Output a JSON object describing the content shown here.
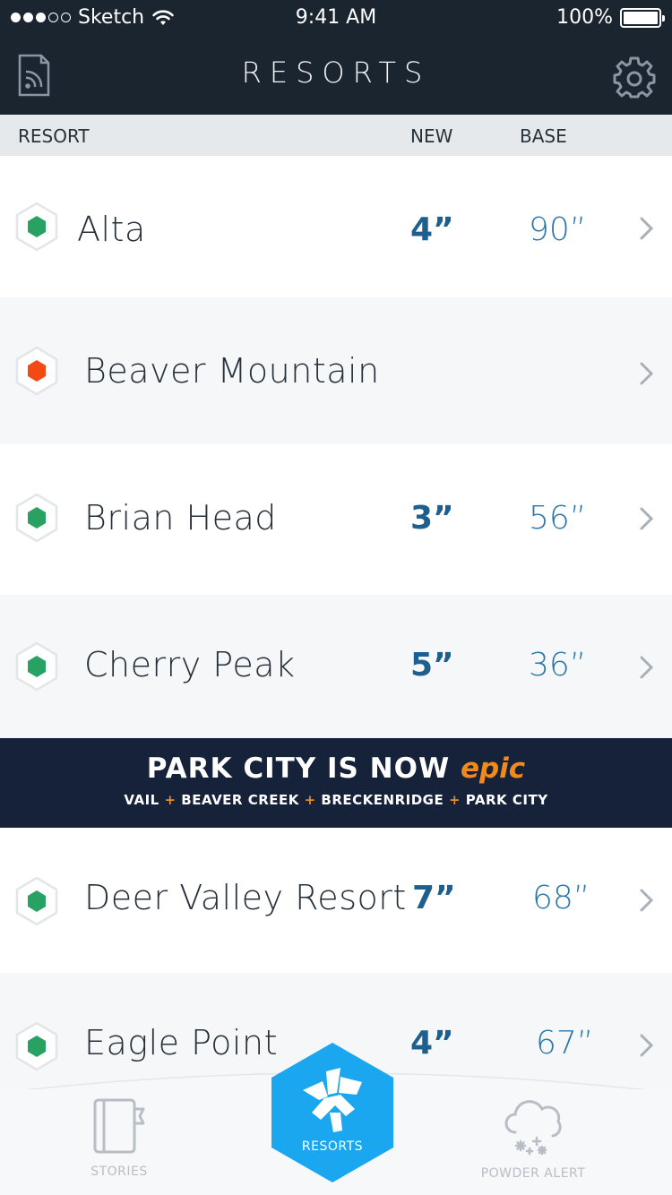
{
  "status_bar": {
    "carrier": "Sketch",
    "time": "9:41 AM",
    "battery": "100%"
  },
  "header": {
    "title": "RESORTS"
  },
  "columns": {
    "resort": "RESORT",
    "new": "NEW",
    "base": "BASE"
  },
  "resorts": [
    {
      "name": "Alta",
      "new": "4”",
      "base": "90”",
      "status": "open",
      "status_color": "#27a262"
    },
    {
      "name": "Beaver Mountain",
      "new": "",
      "base": "",
      "status": "closed",
      "status_color": "#f24a12"
    },
    {
      "name": "Brian Head",
      "new": "3”",
      "base": "56”",
      "status": "open",
      "status_color": "#27a262"
    },
    {
      "name": "Cherry Peak",
      "new": "5”",
      "base": "36”",
      "status": "open",
      "status_color": "#27a262"
    },
    {
      "name": "Deer Valley Resort",
      "new": "7”",
      "base": "68”",
      "status": "open",
      "status_color": "#27a262"
    },
    {
      "name": "Eagle Point",
      "new": "4”",
      "base": "67”",
      "status": "open",
      "status_color": "#27a262"
    }
  ],
  "banner": {
    "headline": "PARK CITY IS NOW",
    "brand": "epic",
    "locations": [
      "VAIL",
      "BEAVER CREEK",
      "BRECKENRIDGE",
      "PARK CITY"
    ],
    "separator": "+"
  },
  "tabs": {
    "stories": "STORIES",
    "resorts": "RESORTS",
    "powder_alert": "POWDER ALERT"
  },
  "colors": {
    "header_bg": "#1b2530",
    "accent_blue": "#1aa7f0",
    "new_text": "#1d5f8f",
    "base_text": "#2b77a8",
    "banner_bg": "#16213a",
    "banner_accent": "#f08a1d"
  }
}
